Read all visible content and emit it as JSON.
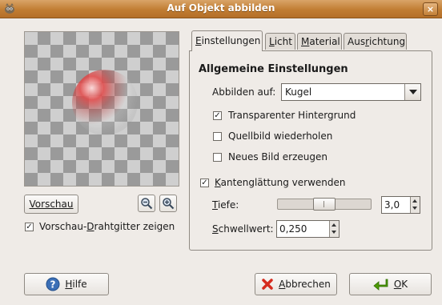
{
  "window": {
    "title": "Auf Objekt abbilden",
    "close_glyph": "×"
  },
  "preview": {
    "button_label": "Vorschau",
    "zoom_out_icon": "zoom-out-icon",
    "zoom_in_icon": "zoom-in-icon",
    "wireframe_label_pre": "Vorschau-",
    "wireframe_label_mnemonic": "D",
    "wireframe_label_post": "rahtgitter zeigen",
    "wireframe_checked": true
  },
  "tabs": [
    {
      "pre": "",
      "mnemonic": "E",
      "post": "instellungen",
      "active": true
    },
    {
      "pre": "",
      "mnemonic": "L",
      "post": "icht",
      "active": false
    },
    {
      "pre": "",
      "mnemonic": "M",
      "post": "aterial",
      "active": false
    },
    {
      "pre": "Aus",
      "mnemonic": "r",
      "post": "ichtung",
      "active": false
    }
  ],
  "general": {
    "heading": "Allgemeine Einstellungen",
    "map_to_label": "Abbilden auf:",
    "map_to_value": "Kugel",
    "transparent_bg_label": "Transparenter Hintergrund",
    "transparent_bg_checked": true,
    "tile_source_label": "Quellbild wiederholen",
    "tile_source_checked": false,
    "new_image_label": "Neues Bild erzeugen",
    "new_image_checked": false,
    "antialias_mnemonic": "K",
    "antialias_post": "antenglättung verwenden",
    "antialias_checked": true,
    "depth_mnemonic": "T",
    "depth_post": "iefe:",
    "depth_value": "3,0",
    "depth_fraction": 0.5,
    "threshold_mnemonic": "S",
    "threshold_post": "chwellwert:",
    "threshold_value": "0,250"
  },
  "footer": {
    "help_mnemonic": "H",
    "help_post": "ilfe",
    "cancel_mnemonic": "A",
    "cancel_post": "bbrechen",
    "ok_mnemonic": "O",
    "ok_post": "K"
  },
  "colors": {
    "titlebar": "#c17d33",
    "help_icon": "#3b6fb6",
    "cancel_icon": "#d52b1e",
    "ok_icon": "#4e9a06"
  },
  "check_glyph": "✓"
}
